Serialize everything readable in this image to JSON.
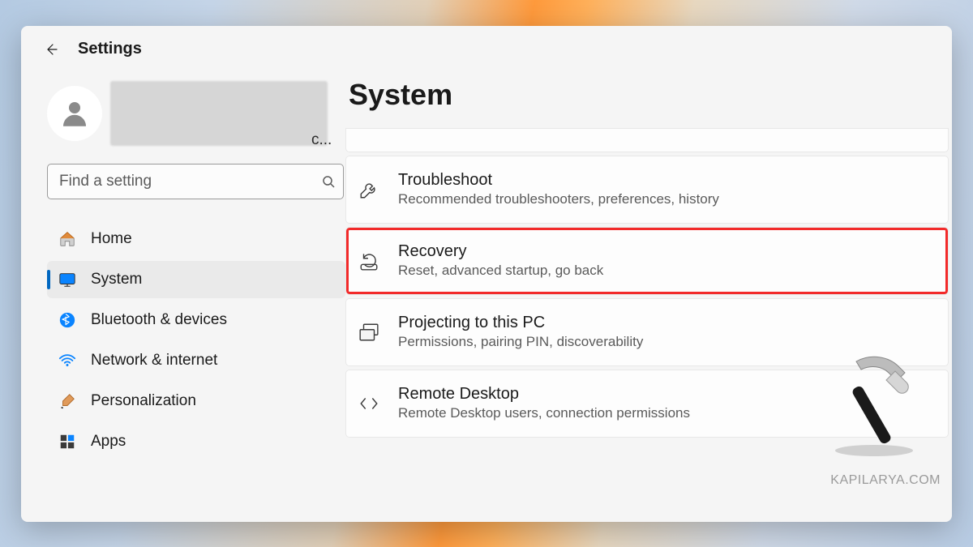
{
  "app": {
    "title": "Settings"
  },
  "account": {
    "truncated": "c..."
  },
  "search": {
    "placeholder": "Find a setting"
  },
  "sidebar": {
    "items": [
      {
        "label": "Home"
      },
      {
        "label": "System"
      },
      {
        "label": "Bluetooth & devices"
      },
      {
        "label": "Network & internet"
      },
      {
        "label": "Personalization"
      },
      {
        "label": "Apps"
      }
    ],
    "selectedIndex": 1
  },
  "page": {
    "title": "System"
  },
  "settings": [
    {
      "title": "",
      "desc": ""
    },
    {
      "title": "Troubleshoot",
      "desc": "Recommended troubleshooters, preferences, history"
    },
    {
      "title": "Recovery",
      "desc": "Reset, advanced startup, go back",
      "highlighted": true
    },
    {
      "title": "Projecting to this PC",
      "desc": "Permissions, pairing PIN, discoverability"
    },
    {
      "title": "Remote Desktop",
      "desc": "Remote Desktop users, connection permissions"
    }
  ],
  "watermark": "KAPILARYA.COM"
}
